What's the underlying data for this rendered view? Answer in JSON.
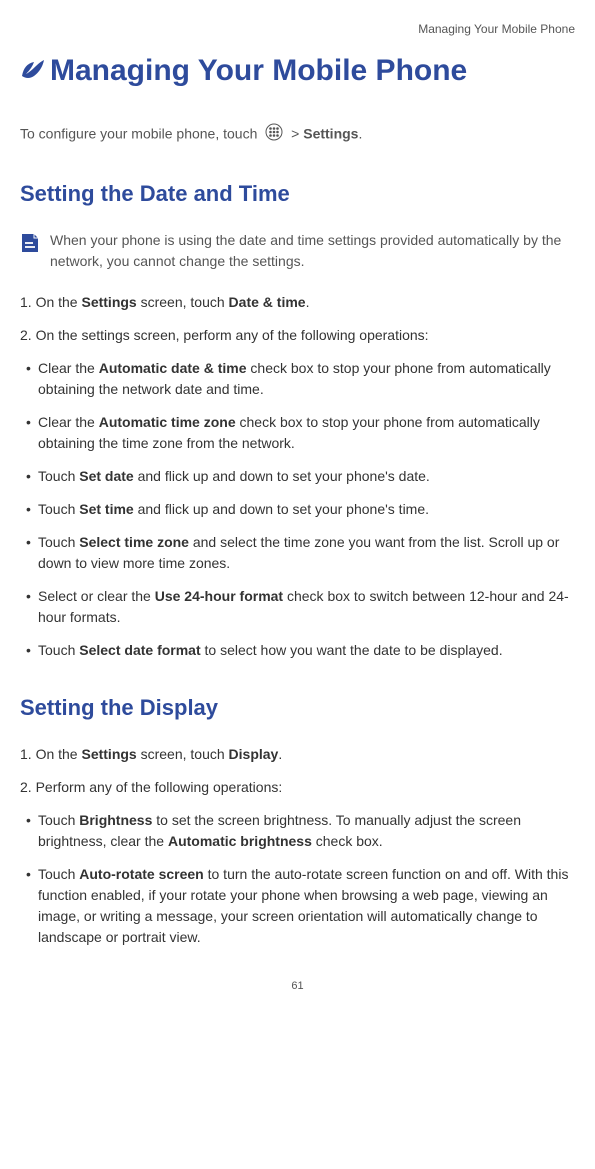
{
  "header": "Managing Your Mobile Phone",
  "title": "Managing Your Mobile Phone",
  "intro_prefix": "To configure your mobile phone, touch ",
  "intro_suffix": " > ",
  "intro_bold": "Settings",
  "intro_end": ".",
  "section1": {
    "heading": "Setting the Date and Time",
    "note": "When your phone is using the date and time settings provided automatically by the network, you cannot change the settings.",
    "step1_prefix": "1. On the ",
    "step1_bold1": "Settings",
    "step1_mid": " screen, touch ",
    "step1_bold2": "Date & time",
    "step1_end": ".",
    "step2": "2. On the settings screen, perform any of the following operations:",
    "bullets": [
      {
        "pre": "Clear the ",
        "bold": "Automatic date & time",
        "post": " check box to stop your phone from automatically obtaining the network date and time."
      },
      {
        "pre": "Clear the ",
        "bold": "Automatic time zone",
        "post": " check box to stop your phone from automatically obtaining the time zone from the network."
      },
      {
        "pre": "Touch ",
        "bold": "Set date",
        "post": " and flick up and down to set your phone's date."
      },
      {
        "pre": "Touch ",
        "bold": "Set time",
        "post": " and flick up and down to set your phone's time."
      },
      {
        "pre": "Touch ",
        "bold": "Select time zone",
        "post": " and select the time zone you want from the list. Scroll up or down to view more time zones."
      },
      {
        "pre": "Select or clear the ",
        "bold": "Use 24-hour format",
        "post": " check box to switch between 12-hour and 24-hour formats."
      },
      {
        "pre": "Touch ",
        "bold": "Select date format",
        "post": " to select how you want the date to be displayed."
      }
    ]
  },
  "section2": {
    "heading": "Setting the Display",
    "step1_prefix": "1. On the ",
    "step1_bold1": "Settings",
    "step1_mid": " screen, touch ",
    "step1_bold2": "Display",
    "step1_end": ".",
    "step2": "2. Perform any of the following operations:",
    "bullets": [
      {
        "pre": "Touch ",
        "bold": "Brightness",
        "post": " to set the screen brightness. To manually adjust the screen brightness, clear the ",
        "bold2": "Automatic brightness",
        "post2": " check box."
      },
      {
        "pre": "Touch ",
        "bold": "Auto-rotate screen",
        "post": " to turn the auto-rotate screen function on and off. With this function enabled, if your rotate your phone when browsing a web page, viewing an image, or writing a message, your screen orientation will automatically change to landscape or portrait view."
      }
    ]
  },
  "page_number": "61"
}
